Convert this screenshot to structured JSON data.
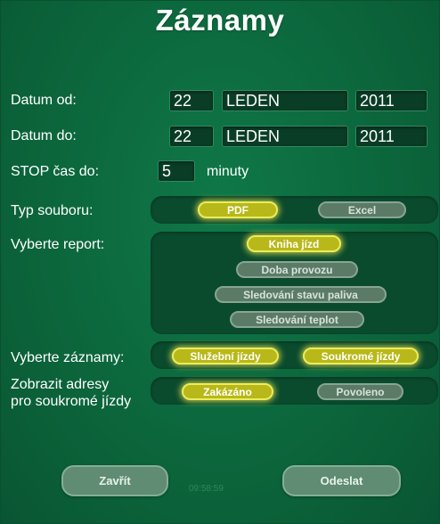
{
  "title": "Záznamy",
  "date_from": {
    "label": "Datum od:",
    "day": "22",
    "month": "LEDEN",
    "year": "2011"
  },
  "date_to": {
    "label": "Datum do:",
    "day": "22",
    "month": "LEDEN",
    "year": "2011"
  },
  "stop_time": {
    "label": "STOP čas do:",
    "value": "5",
    "unit": "minuty"
  },
  "file_type": {
    "label": "Typ souboru:",
    "options": [
      {
        "label": "PDF",
        "selected": true
      },
      {
        "label": "Excel",
        "selected": false
      }
    ]
  },
  "report": {
    "label": "Vyberte report:",
    "options": [
      {
        "label": "Kniha jízd",
        "selected": true
      },
      {
        "label": "Doba provozu",
        "selected": false
      },
      {
        "label": "Sledování stavu paliva",
        "selected": false
      },
      {
        "label": "Sledování teplot",
        "selected": false
      }
    ]
  },
  "records": {
    "label": "Vyberte záznamy:",
    "options": [
      {
        "label": "Služební jízdy",
        "selected": true
      },
      {
        "label": "Soukromé jízdy",
        "selected": true
      }
    ]
  },
  "address": {
    "label_line1": "Zobrazit adresy",
    "label_line2": "pro soukromé jízdy",
    "options": [
      {
        "label": "Zakázáno",
        "selected": true
      },
      {
        "label": "Povoleno",
        "selected": false
      }
    ]
  },
  "buttons": {
    "close": "Zavřít",
    "send": "Odeslat"
  },
  "clock": "09:58:59"
}
